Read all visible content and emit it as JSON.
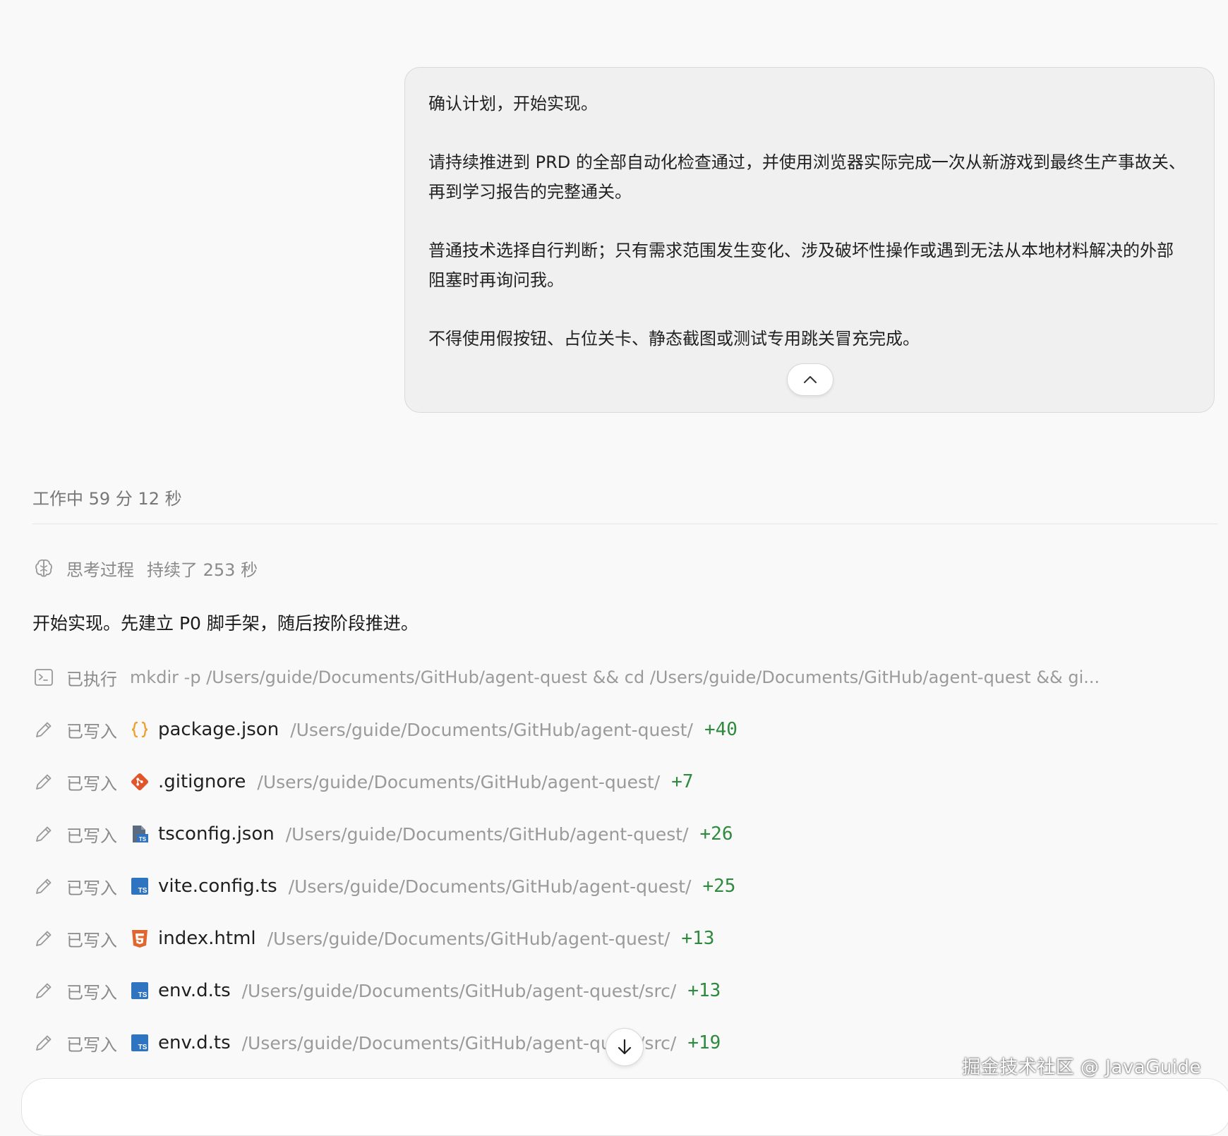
{
  "user_message": {
    "paragraphs": [
      "确认计划，开始实现。",
      "请持续推进到 PRD 的全部自动化检查通过，并使用浏览器实际完成一次从新游戏到最终生产事故关、再到学习报告的完整通关。",
      "普通技术选择自行判断；只有需求范围发生变化、涉及破坏性操作或遇到无法从本地材料解决的外部阻塞时再询问我。",
      "不得使用假按钮、占位关卡、静态截图或测试专用跳关冒充完成。"
    ]
  },
  "work_status": "工作中 59 分 12 秒",
  "thinking": {
    "label": "思考过程",
    "duration": "持续了 253 秒"
  },
  "assistant_text": "开始实现。先建立 P0 脚手架，随后按阶段推进。",
  "executed": {
    "verb": "已执行",
    "command": "mkdir -p /Users/guide/Documents/GitHub/agent-quest && cd /Users/guide/Documents/GitHub/agent-quest && gi..."
  },
  "file_writes": [
    {
      "verb": "已写入",
      "icon": "json-braces-icon",
      "name": "package.json",
      "path": "/Users/guide/Documents/GitHub/agent-quest/",
      "diff": "+40"
    },
    {
      "verb": "已写入",
      "icon": "git-icon",
      "name": ".gitignore",
      "path": "/Users/guide/Documents/GitHub/agent-quest/",
      "diff": "+7"
    },
    {
      "verb": "已写入",
      "icon": "tsconfig-icon",
      "name": "tsconfig.json",
      "path": "/Users/guide/Documents/GitHub/agent-quest/",
      "diff": "+26"
    },
    {
      "verb": "已写入",
      "icon": "typescript-icon",
      "name": "vite.config.ts",
      "path": "/Users/guide/Documents/GitHub/agent-quest/",
      "diff": "+25"
    },
    {
      "verb": "已写入",
      "icon": "html5-icon",
      "name": "index.html",
      "path": "/Users/guide/Documents/GitHub/agent-quest/",
      "diff": "+13"
    },
    {
      "verb": "已写入",
      "icon": "typescript-icon",
      "name": "env.d.ts",
      "path": "/Users/guide/Documents/GitHub/agent-quest/src/",
      "diff": "+13"
    },
    {
      "verb": "已写入",
      "icon": "typescript-icon",
      "name": "env.d.ts",
      "path": "/Users/guide/Documents/GitHub/agent-quest/src/",
      "diff": "+19"
    }
  ],
  "watermark": "掘金技术社区 @ JavaGuide",
  "colors": {
    "diff_green": "#2e8a3e",
    "json_orange": "#f0a030",
    "git_red": "#e0552b",
    "ts_blue": "#2f74c0",
    "html_orange": "#e2652d"
  }
}
